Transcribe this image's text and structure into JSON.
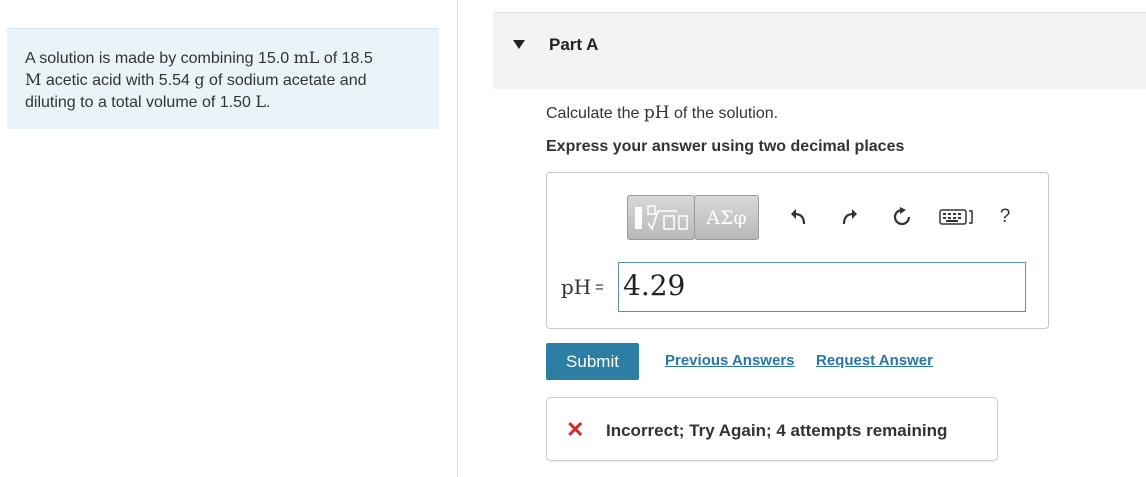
{
  "problem": {
    "part1": "A solution is made by combining 15.0 ",
    "unit_ml": "mL",
    "part2": " of 18.5",
    "unit_m": "M",
    "part3": " acetic acid with 5.54 ",
    "unit_g": "g",
    "part4": " of sodium acetate and diluting to a total volume of 1.50 ",
    "unit_l": "L",
    "part5": "."
  },
  "part": {
    "title": "Part A",
    "toggle_icon": "caret-down-icon"
  },
  "question": {
    "prefix": "Calculate the ",
    "ph_symbol": "pH",
    "suffix": " of the solution."
  },
  "instruction": "Express your answer using two decimal places",
  "toolbar": {
    "templates_icon": "templates-icon",
    "symbols_label": "ΑΣφ",
    "undo_icon": "undo-icon",
    "redo_icon": "redo-icon",
    "reset_icon": "reset-icon",
    "keyboard_icon": "keyboard-icon",
    "help_label": "?"
  },
  "answer": {
    "label": "pH",
    "equals": "=",
    "value": "4.29"
  },
  "actions": {
    "submit_label": "Submit",
    "previous_answers_label": "Previous Answers",
    "request_answer_label": "Request Answer"
  },
  "feedback": {
    "icon": "incorrect-x-icon",
    "text": "Incorrect; Try Again; 4 attempts remaining"
  },
  "colors": {
    "problem_bg": "#e8f4f8",
    "submit_bg": "#2d7ea5",
    "link": "#2a76a8",
    "error": "#d02b27"
  }
}
